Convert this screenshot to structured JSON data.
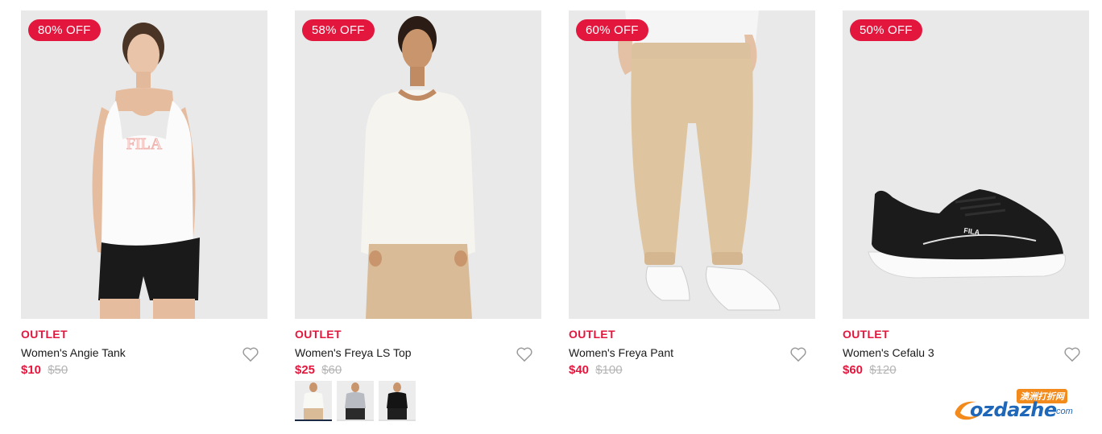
{
  "products": [
    {
      "badge": "80% OFF",
      "label": "OUTLET",
      "name": "Women's Angie Tank",
      "price": "$10",
      "was_price": "$50"
    },
    {
      "badge": "58% OFF",
      "label": "OUTLET",
      "name": "Women's Freya LS Top",
      "price": "$25",
      "was_price": "$60",
      "swatches": [
        "white",
        "grey",
        "black"
      ]
    },
    {
      "badge": "60% OFF",
      "label": "OUTLET",
      "name": "Women's Freya Pant",
      "price": "$40",
      "was_price": "$100"
    },
    {
      "badge": "50% OFF",
      "label": "OUTLET",
      "name": "Women's Cefalu 3",
      "price": "$60",
      "was_price": "$120"
    }
  ],
  "watermark": {
    "tag": "澳洲打折网",
    "text": "ozdazhe",
    "suffix": ".com"
  },
  "colors": {
    "accent": "#e3173e",
    "image_bg": "#e8e8e8",
    "strike_price": "#b5b5b5"
  },
  "icons": [
    "heart-icon"
  ]
}
